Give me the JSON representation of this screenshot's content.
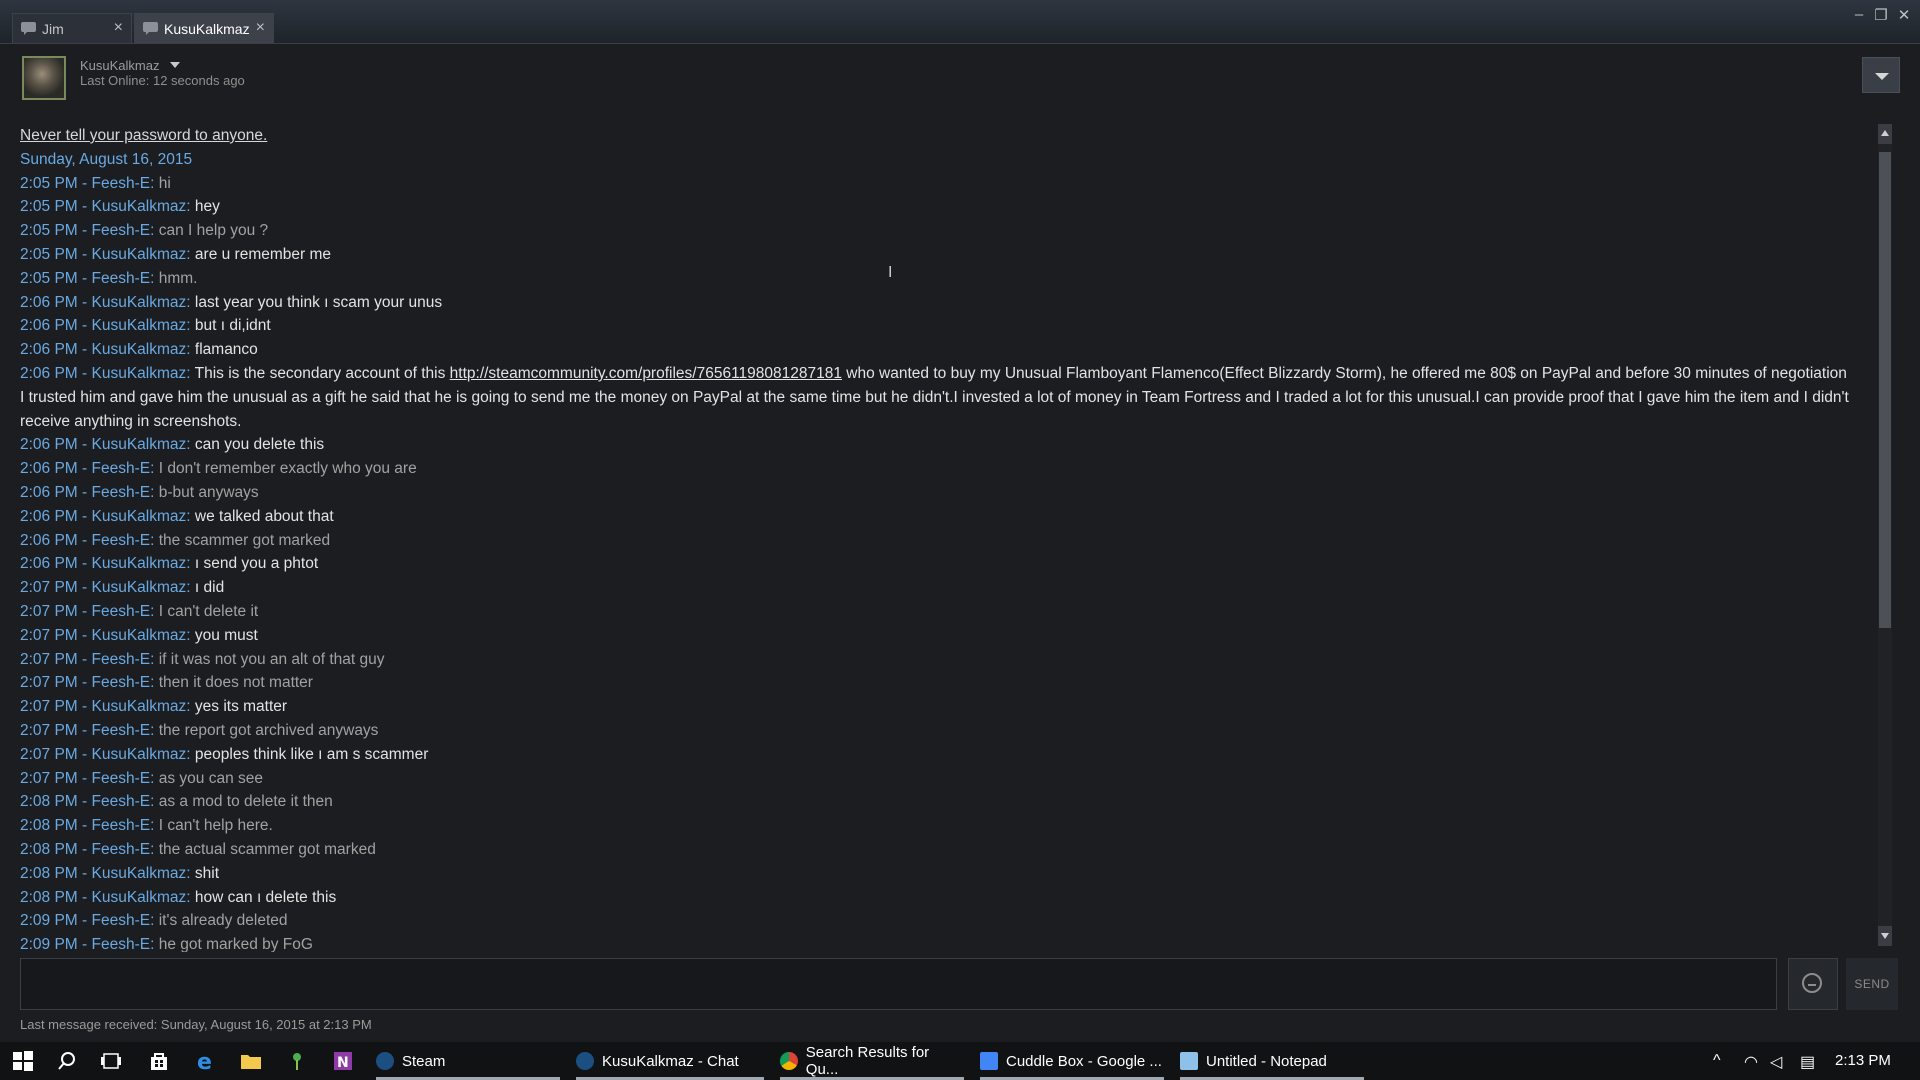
{
  "window": {
    "tabs": [
      {
        "label": "Jim",
        "active": false
      },
      {
        "label": "KusuKalkmaz",
        "active": true
      }
    ]
  },
  "header": {
    "friend_name": "KusuKalkmaz",
    "status": "Last Online: 12 seconds ago"
  },
  "chat": {
    "warning": "Never tell your password to anyone.",
    "date": "Sunday, August 16, 2015",
    "link_text": "http://steamcommunity.com/profiles/76561198081287181",
    "messages": [
      {
        "time": "2:05 PM",
        "sender": "Feesh-E",
        "text": "hi",
        "self": true
      },
      {
        "time": "2:05 PM",
        "sender": "KusuKalkmaz",
        "text": "hey",
        "self": false
      },
      {
        "time": "2:05 PM",
        "sender": "Feesh-E",
        "text": "can I help you ?",
        "self": true
      },
      {
        "time": "2:05 PM",
        "sender": "KusuKalkmaz",
        "text": "are u remember me",
        "self": false
      },
      {
        "time": "2:05 PM",
        "sender": "Feesh-E",
        "text": "hmm.",
        "self": true
      },
      {
        "time": "2:06 PM",
        "sender": "KusuKalkmaz",
        "text": "last year you think ı scam your unus",
        "self": false
      },
      {
        "time": "2:06 PM",
        "sender": "KusuKalkmaz",
        "text": "but ı di,idnt",
        "self": false
      },
      {
        "time": "2:06 PM",
        "sender": "KusuKalkmaz",
        "text": "flamanco",
        "self": false
      },
      {
        "time": "2:06 PM",
        "sender": "KusuKalkmaz",
        "text_before": "This is the secondary account of this ",
        "text_after": " who wanted to buy my Unusual Flamboyant Flamenco(Effect Blizzardy Storm), he offered me 80$ on PayPal and before 30 minutes of negotiation I trusted him and gave him the unusual as a gift he said that he is going to send me the money on PayPal at the same time but he didn't.I invested a lot of money in Team Fortress and I traded a lot for this unusual.I can provide proof that I gave him the item and I didn't receive anything in screenshots.",
        "self": false,
        "has_link": true
      },
      {
        "time": "2:06 PM",
        "sender": "KusuKalkmaz",
        "text": "can you delete this",
        "self": false
      },
      {
        "time": "2:06 PM",
        "sender": "Feesh-E",
        "text": "I don't remember exactly who you are",
        "self": true
      },
      {
        "time": "2:06 PM",
        "sender": "Feesh-E",
        "text": "b-but anyways",
        "self": true
      },
      {
        "time": "2:06 PM",
        "sender": "KusuKalkmaz",
        "text": "we talked about that",
        "self": false
      },
      {
        "time": "2:06 PM",
        "sender": "Feesh-E",
        "text": "the scammer got marked",
        "self": true
      },
      {
        "time": "2:06 PM",
        "sender": "KusuKalkmaz",
        "text": "ı send you a phtot",
        "self": false
      },
      {
        "time": "2:07 PM",
        "sender": "KusuKalkmaz",
        "text": "ı did",
        "self": false
      },
      {
        "time": "2:07 PM",
        "sender": "Feesh-E",
        "text": "I can't delete it",
        "self": true
      },
      {
        "time": "2:07 PM",
        "sender": "KusuKalkmaz",
        "text": "you must",
        "self": false
      },
      {
        "time": "2:07 PM",
        "sender": "Feesh-E",
        "text": "if it was not you an alt of that guy",
        "self": true
      },
      {
        "time": "2:07 PM",
        "sender": "Feesh-E",
        "text": "then it does not matter",
        "self": true
      },
      {
        "time": "2:07 PM",
        "sender": "KusuKalkmaz",
        "text": "yes its matter",
        "self": false
      },
      {
        "time": "2:07 PM",
        "sender": "Feesh-E",
        "text": "the report got archived anyways",
        "self": true
      },
      {
        "time": "2:07 PM",
        "sender": "KusuKalkmaz",
        "text": "peoples think like ı am s scammer",
        "self": false
      },
      {
        "time": "2:07 PM",
        "sender": "Feesh-E",
        "text": "as you can see",
        "self": true
      },
      {
        "time": "2:08 PM",
        "sender": "Feesh-E",
        "text": "as a mod to delete it then",
        "self": true
      },
      {
        "time": "2:08 PM",
        "sender": "Feesh-E",
        "text": "I can't help here.",
        "self": true
      },
      {
        "time": "2:08 PM",
        "sender": "Feesh-E",
        "text": "the actual scammer got marked",
        "self": true
      },
      {
        "time": "2:08 PM",
        "sender": "KusuKalkmaz",
        "text": "shit",
        "self": false
      },
      {
        "time": "2:08 PM",
        "sender": "KusuKalkmaz",
        "text": "how can ı delete this",
        "self": false
      },
      {
        "time": "2:09 PM",
        "sender": "Feesh-E",
        "text": "it's already deleted",
        "self": true
      },
      {
        "time": "2:09 PM",
        "sender": "Feesh-E",
        "text": "he got marked by FoG",
        "self": true
      }
    ]
  },
  "composer": {
    "placeholder": "",
    "send_label": "SEND",
    "last_received": "Last message received: Sunday, August 16, 2015 at 2:13 PM"
  },
  "taskbar": {
    "apps": [
      {
        "label": "Steam",
        "icon": "steam-icon"
      },
      {
        "label": "KusuKalkmaz - Chat",
        "icon": "steam-icon"
      },
      {
        "label": "Search Results for Qu...",
        "icon": "chrome-icon"
      },
      {
        "label": "Cuddle Box - Google ...",
        "icon": "google-icon"
      },
      {
        "label": "Untitled - Notepad",
        "icon": "notepad-icon"
      }
    ],
    "clock": "2:13 PM"
  },
  "colors": {
    "meta_blue": "#6aa9e2",
    "self_text": "#a2a2a2",
    "other_text": "#e3e3e3",
    "background": "#1b1d20"
  }
}
